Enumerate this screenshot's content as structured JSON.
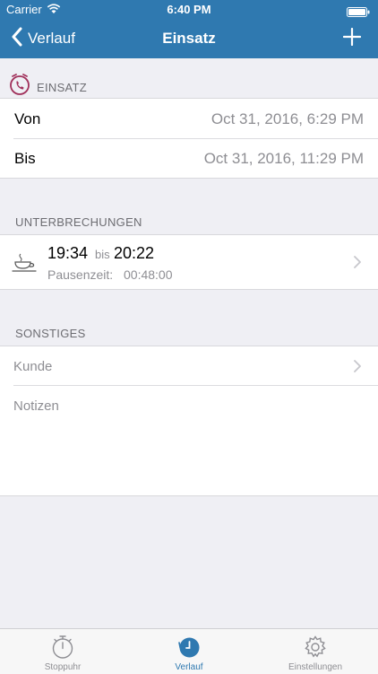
{
  "status_bar": {
    "carrier": "Carrier",
    "time": "6:40 PM"
  },
  "nav": {
    "back_label": "Verlauf",
    "title": "Einsatz"
  },
  "einsatz": {
    "header": "EINSATZ",
    "von_label": "Von",
    "von_value": "Oct 31, 2016, 6:29 PM",
    "bis_label": "Bis",
    "bis_value": "Oct 31, 2016, 11:29 PM"
  },
  "unterbrechungen": {
    "header": "UNTERBRECHUNGEN",
    "item": {
      "start": "19:34",
      "bis": "bis",
      "end": "20:22",
      "pause_label": "Pausenzeit:",
      "pause_value": "00:48:00"
    }
  },
  "sonstiges": {
    "header": "SONSTIGES",
    "kunde_placeholder": "Kunde",
    "notizen_placeholder": "Notizen"
  },
  "tabs": [
    {
      "label": "Stoppuhr",
      "icon": "stopwatch-icon"
    },
    {
      "label": "Verlauf",
      "icon": "history-clock-icon"
    },
    {
      "label": "Einstellungen",
      "icon": "gear-icon"
    }
  ],
  "colors": {
    "nav": "#2f79b0",
    "accent": "#2f79b0",
    "phone_icon": "#a0305a",
    "background": "#efeff4"
  }
}
